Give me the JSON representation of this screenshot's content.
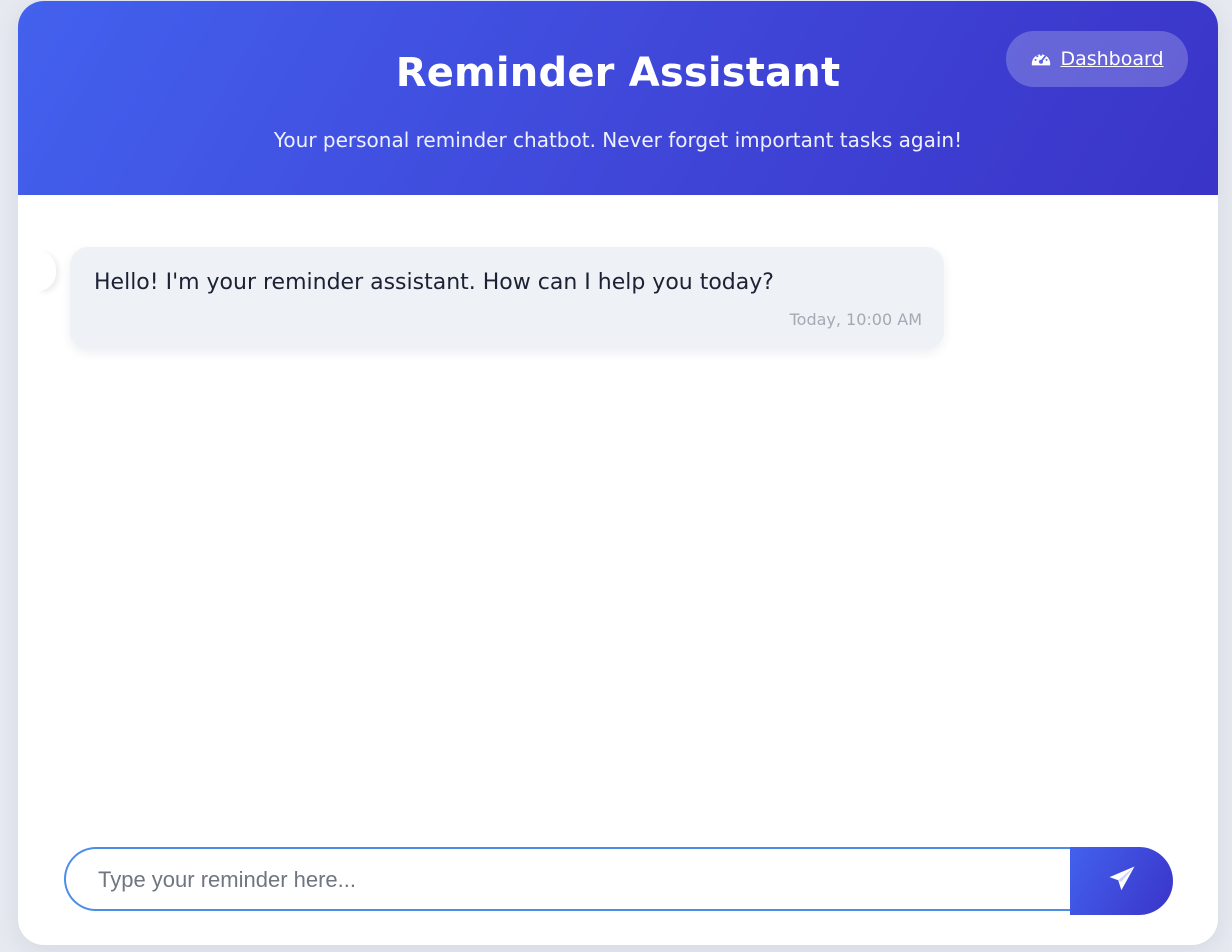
{
  "header": {
    "title": "Reminder Assistant",
    "subtitle": "Your personal reminder chatbot. Never forget important tasks again!",
    "dashboard_label": "Dashboard",
    "dashboard_icon": "gauge-icon"
  },
  "chat": {
    "messages": [
      {
        "sender": "bot",
        "text": "Hello! I'm your reminder assistant. How can I help you today?",
        "time": "Today, 10:00 AM"
      }
    ]
  },
  "composer": {
    "placeholder": "Type your reminder here...",
    "value": "",
    "send_icon": "paper-plane-icon"
  },
  "colors": {
    "accent": "#4361ee",
    "accent_dark": "#3a34c8",
    "input_border": "#4a8fe6",
    "bubble_bg": "#eef1f6"
  }
}
